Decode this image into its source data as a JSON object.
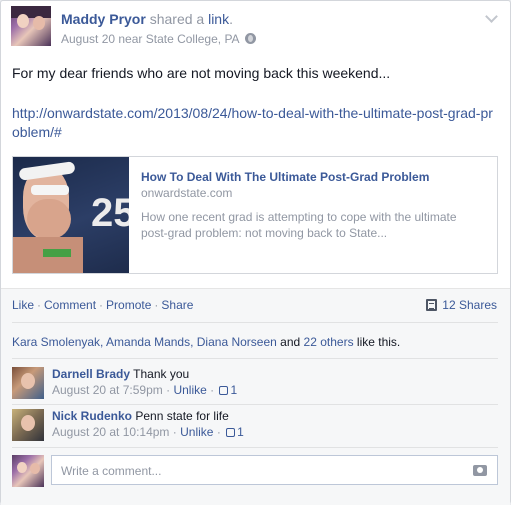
{
  "post": {
    "author": "Maddy Pryor",
    "shared_text": "shared a",
    "link_word": "link",
    "period": ".",
    "meta": "August 20 near State College, PA",
    "text": "For my dear friends who are not moving back this weekend...",
    "url": "http://onwardstate.com/2013/08/24/how-to-deal-with-the-ultimate-post-grad-problem/#"
  },
  "preview": {
    "title": "How To Deal With The Ultimate Post-Grad Problem",
    "domain": "onwardstate.com",
    "description": "How one recent grad is attempting to cope with the ultimate post-grad problem: not moving back to State...",
    "thumb_number": "25"
  },
  "actions": {
    "like": "Like",
    "comment": "Comment",
    "promote": "Promote",
    "share": "Share",
    "separator": "·",
    "shares": "12 Shares"
  },
  "likes": {
    "names": "Kara Smolenyak, Amanda Mands, Diana Norseen",
    "and": "and",
    "others": "22 others",
    "suffix": "like this."
  },
  "comments": [
    {
      "name": "Darnell Brady",
      "text": "Thank you",
      "time": "August 20 at 7:59pm",
      "sep": "·",
      "unlike": "Unlike",
      "likes": "1"
    },
    {
      "name": "Nick Rudenko",
      "text": "Penn state for life",
      "time": "August 20 at 10:14pm",
      "sep": "·",
      "unlike": "Unlike",
      "likes": "1"
    }
  ],
  "composer": {
    "placeholder": "Write a comment..."
  },
  "colors": {
    "link": "#3b5998",
    "muted": "#9197a3",
    "footer_bg": "#f6f7f8"
  }
}
